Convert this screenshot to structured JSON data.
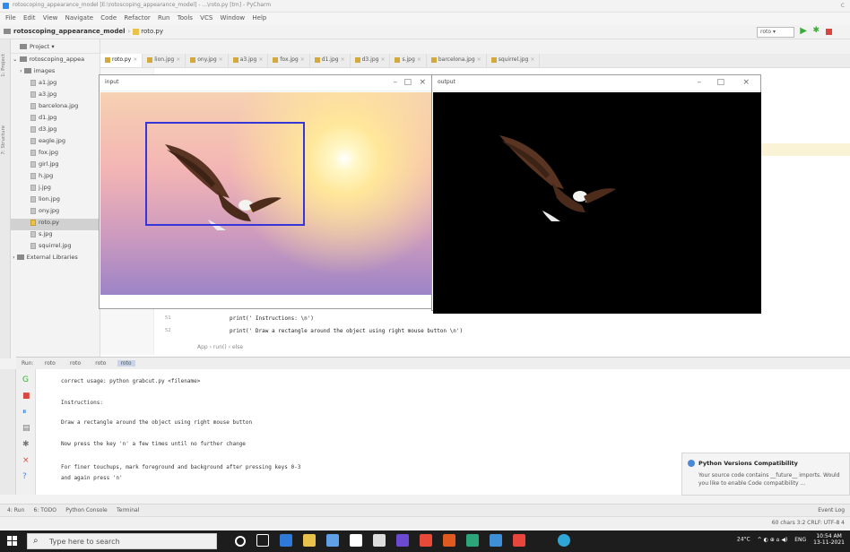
{
  "window": {
    "title": "rotoscoping_appearance_model [E:\\rotoscoping_appearance_model] - ...\\roto.py [tm] - PyCharm"
  },
  "menu": [
    "File",
    "Edit",
    "View",
    "Navigate",
    "Code",
    "Refactor",
    "Run",
    "Tools",
    "VCS",
    "Window",
    "Help"
  ],
  "breadcrumb": {
    "project": "rotoscoping_appearance_model",
    "file": "roto.py"
  },
  "run_config": {
    "name": "roto"
  },
  "project_panel": {
    "title": "Project",
    "root": "rotoscoping_appea",
    "items": [
      {
        "label": "images",
        "type": "folder"
      },
      {
        "label": "a1.jpg",
        "type": "file"
      },
      {
        "label": "a3.jpg",
        "type": "file"
      },
      {
        "label": "barcelona.jpg",
        "type": "file"
      },
      {
        "label": "d1.jpg",
        "type": "file"
      },
      {
        "label": "d3.jpg",
        "type": "file"
      },
      {
        "label": "eagle.jpg",
        "type": "file"
      },
      {
        "label": "fox.jpg",
        "type": "file"
      },
      {
        "label": "girl.jpg",
        "type": "file"
      },
      {
        "label": "h.jpg",
        "type": "file"
      },
      {
        "label": "j.jpg",
        "type": "file"
      },
      {
        "label": "lion.jpg",
        "type": "file"
      },
      {
        "label": "ony.jpg",
        "type": "file"
      },
      {
        "label": "roto.py",
        "type": "py",
        "selected": true
      },
      {
        "label": "s.jpg",
        "type": "file"
      },
      {
        "label": "squirrel.jpg",
        "type": "file"
      },
      {
        "label": "External Libraries",
        "type": "folder"
      }
    ]
  },
  "editor_tabs": [
    {
      "label": "roto.py",
      "active": true
    },
    {
      "label": "lion.jpg"
    },
    {
      "label": "ony.jpg"
    },
    {
      "label": "a3.jpg"
    },
    {
      "label": "fox.jpg"
    },
    {
      "label": "d1.jpg"
    },
    {
      "label": "d3.jpg"
    },
    {
      "label": "s.jpg"
    },
    {
      "label": "barcelona.jpg"
    },
    {
      "label": "squirrel.jpg"
    }
  ],
  "editor": {
    "lines": [
      {
        "no": "51",
        "code": "print(' Instructions: \\n')"
      },
      {
        "no": "52",
        "code": "print(' Draw a rectangle around the object using right mouse button \\n')"
      }
    ],
    "crumb": "App  ›  run()  ›  else"
  },
  "input_window": {
    "title": "input",
    "buttons": [
      "–",
      "□",
      "×"
    ]
  },
  "output_window": {
    "title": "output",
    "buttons": [
      "–",
      "□",
      "×"
    ]
  },
  "run_panel": {
    "label": "Run:",
    "tabs": [
      "roto",
      "roto",
      "roto",
      "roto"
    ],
    "console": [
      "correct usage: python grabcut.py <filename>",
      "Instructions:",
      "Draw a rectangle around the object using right mouse button",
      "Now press the key 'n' a few times until no further change",
      "For finer touchups, mark foreground and background after pressing keys 0-3",
      "                 and again press 'n'"
    ]
  },
  "notification": {
    "title": "Python Versions Compatibility",
    "body": "Your source code contains __future__ imports. Would you like to enable Code compatibility ..."
  },
  "bottom_tabs": [
    "4: Run",
    "6: TODO",
    "Python Console",
    "Terminal"
  ],
  "event_log": "Event Log",
  "statusbar": "60 chars   3:2   CRLF:  UTF-8  4",
  "taskbar": {
    "search_placeholder": "Type here to search",
    "weather": "24°C",
    "lang": "ENG",
    "time": "10:54 AM",
    "date": "13-11-2021"
  }
}
